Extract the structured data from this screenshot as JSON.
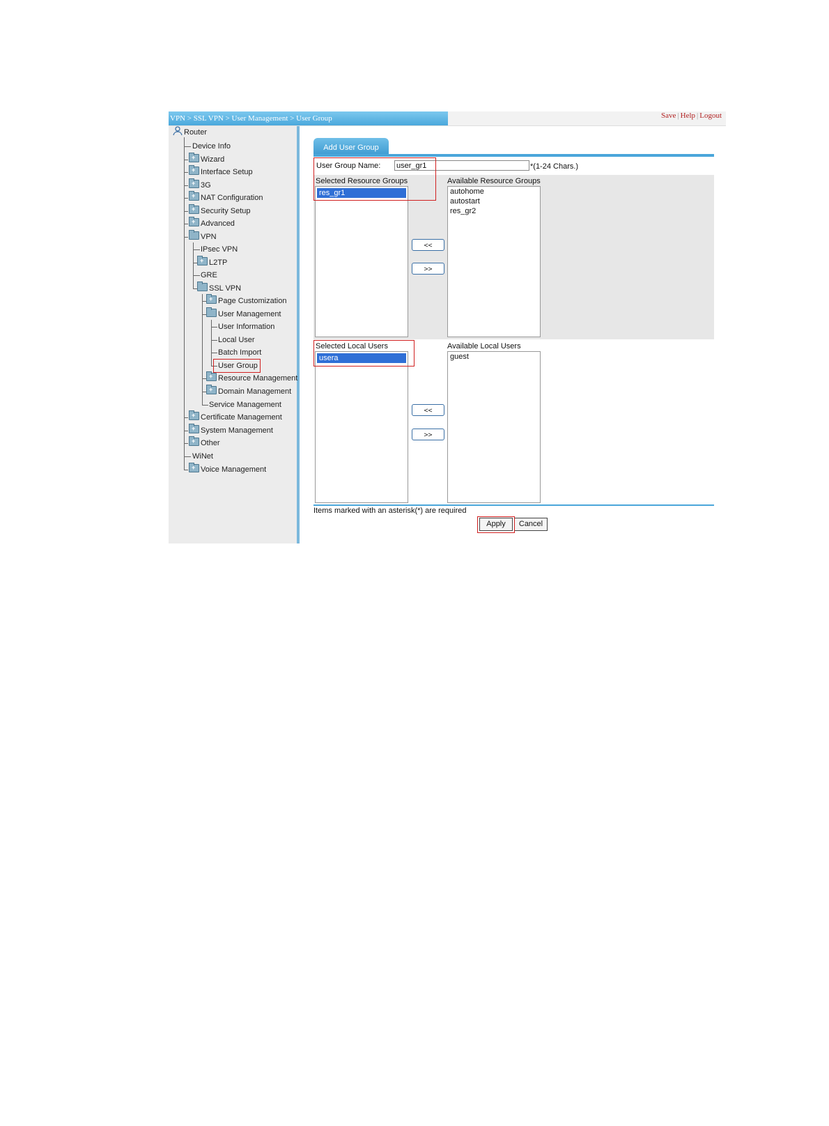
{
  "header": {
    "breadcrumb": "VPN > SSL VPN > User Management > User Group",
    "links": {
      "save": "Save",
      "help": "Help",
      "logout": "Logout",
      "separator": "|"
    }
  },
  "sidebar": {
    "root": "Router",
    "items": {
      "device_info": "Device Info",
      "wizard": "Wizard",
      "interface_setup": "Interface Setup",
      "g3": "3G",
      "nat": "NAT Configuration",
      "security": "Security Setup",
      "advanced": "Advanced",
      "vpn": "VPN",
      "ipsec": "IPsec VPN",
      "l2tp": "L2TP",
      "gre": "GRE",
      "sslvpn": "SSL VPN",
      "page_custom": "Page Customization",
      "user_mgmt": "User Management",
      "user_info": "User Information",
      "local_user": "Local User",
      "batch_import": "Batch Import",
      "user_group": "User Group",
      "resource_mgmt": "Resource Management",
      "domain_mgmt": "Domain Management",
      "service_mgmt": "Service Management",
      "cert_mgmt": "Certificate Management",
      "system_mgmt": "System Management",
      "other": "Other",
      "winet": "WiNet",
      "voice_mgmt": "Voice Management"
    },
    "selected": "User Group"
  },
  "main": {
    "tab": "Add User Group",
    "group_name": {
      "label": "User Group Name:",
      "value": "user_gr1",
      "hint": "*(1-24 Chars.)"
    },
    "resource": {
      "selected_label": "Selected Resource Groups",
      "available_label": "Available Resource Groups",
      "selected": [
        "res_gr1"
      ],
      "available": [
        "autohome",
        "autostart",
        "res_gr2"
      ]
    },
    "users": {
      "selected_label": "Selected Local Users",
      "available_label": "Available Local Users",
      "selected": [
        "usera"
      ],
      "available": [
        "guest"
      ]
    },
    "move_left": "<<",
    "move_right": ">>",
    "required_note": "Items marked with an asterisk(*) are required",
    "apply": "Apply",
    "cancel": "Cancel"
  },
  "colors": {
    "accent": "#4aa6da",
    "highlight_box": "#d02020",
    "selection": "#2f6fd6"
  }
}
